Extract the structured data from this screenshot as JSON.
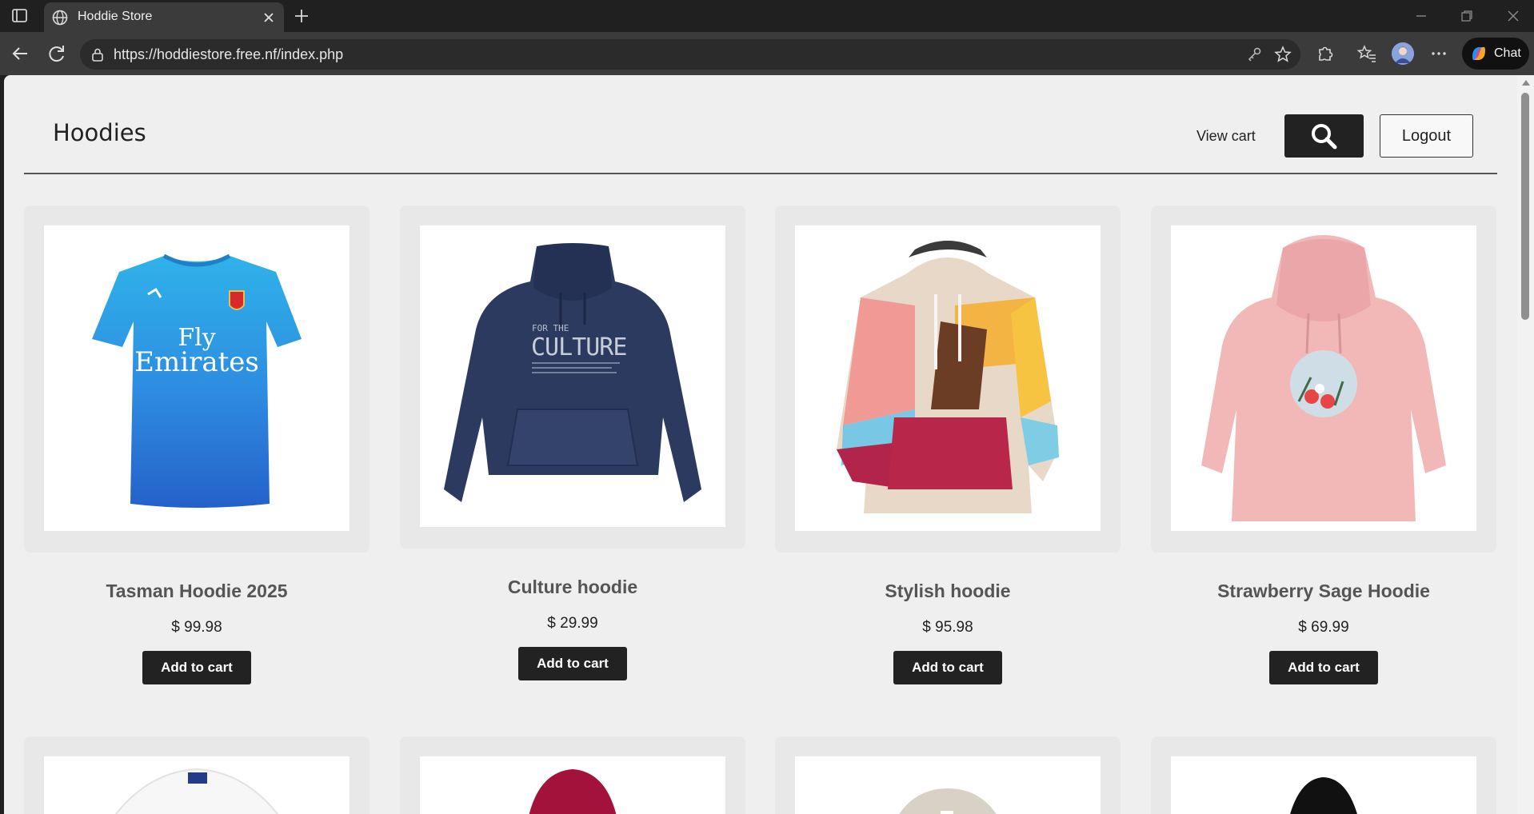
{
  "browser": {
    "tab_title": "Hoddie Store",
    "url": "https://hoddiestore.free.nf/index.php",
    "chat_label": "Chat"
  },
  "header": {
    "title": "Hoodies",
    "view_cart": "View cart",
    "logout": "Logout"
  },
  "products": [
    {
      "name": "Tasman Hoodie 2025",
      "price": "$ 99.98",
      "button": "Add to cart",
      "color": "#2ea8e6"
    },
    {
      "name": "Culture hoodie",
      "price": "$ 29.99",
      "button": "Add to cart",
      "color": "#2a3558"
    },
    {
      "name": "Stylish hoodie",
      "price": "$ 95.98",
      "button": "Add to cart",
      "color": "#e8a07a"
    },
    {
      "name": "Strawberry Sage Hoodie",
      "price": "$ 69.99",
      "button": "Add to cart",
      "color": "#f1b7b7"
    }
  ],
  "shirt_print": {
    "line1": "Fly",
    "line2": "Emirates"
  },
  "hoodie_print": {
    "line1": "FOR THE",
    "line2": "CULTURE"
  },
  "next_row_colors": [
    "#ffffff",
    "#a3123a",
    "#d8d2c6",
    "#111111"
  ],
  "icons": {
    "search": "search-icon",
    "back": "arrow-left-icon",
    "refresh": "refresh-icon",
    "lock": "lock-icon",
    "favorite": "star-icon",
    "extensions": "puzzle-icon",
    "favorites": "favorites-icon",
    "more": "ellipsis-icon"
  }
}
